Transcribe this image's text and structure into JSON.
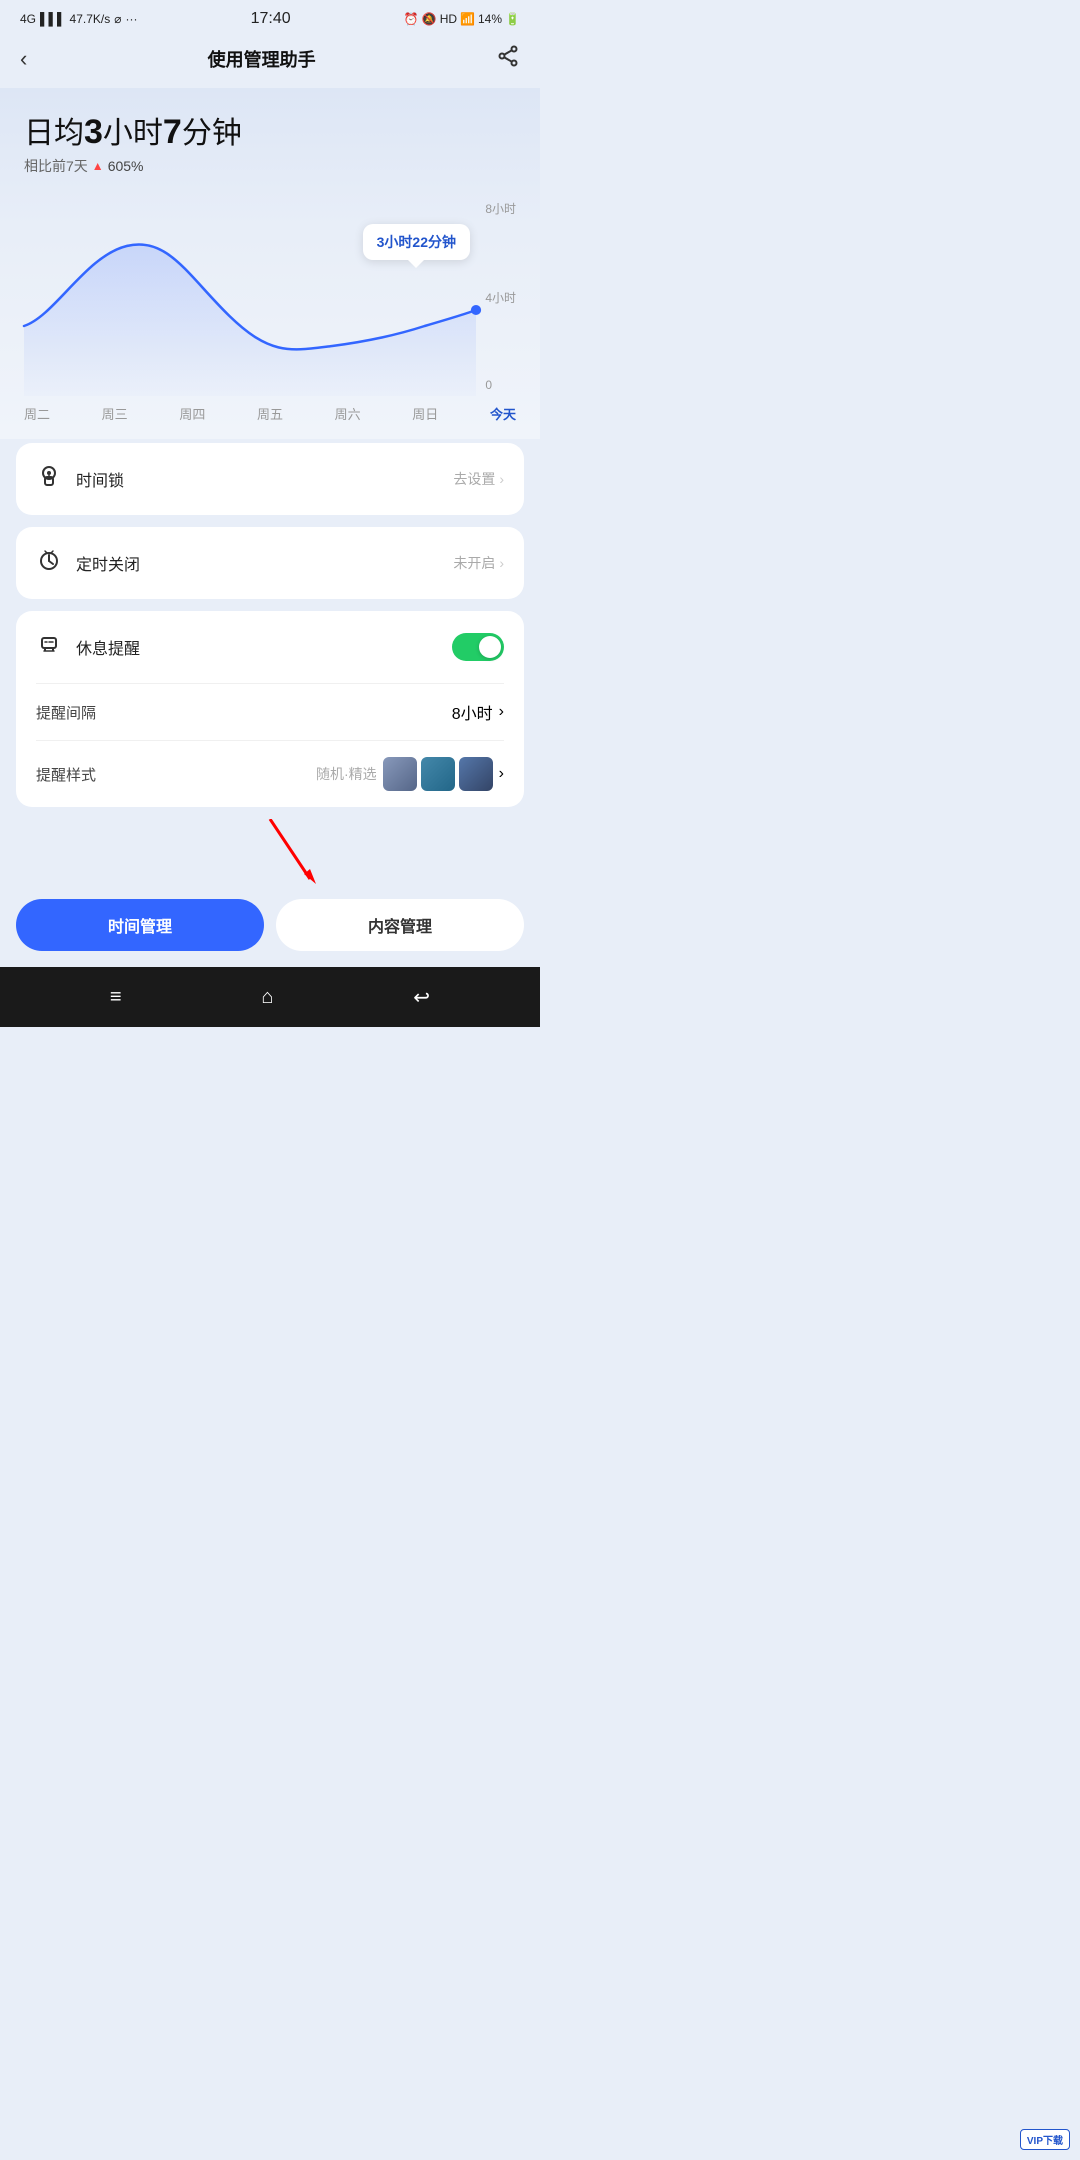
{
  "statusBar": {
    "network": "4G",
    "signal": "4G.ill",
    "speed": "47.7K/s",
    "usb": "⌀",
    "dots": "···",
    "time": "17:40",
    "alarm": "⏰",
    "mute": "🔕",
    "hd": "HD",
    "wifi": "WiFi",
    "battery": "14%"
  },
  "header": {
    "backLabel": "‹",
    "title": "使用管理助手",
    "shareLabel": "⎋"
  },
  "stats": {
    "prefixText": "日均",
    "hours": "3",
    "hoursLabel": "小时",
    "minutes": "7",
    "minutesLabel": "分钟",
    "comparisonText": "相比前7天",
    "arrowLabel": "▲",
    "percentText": "605%"
  },
  "chart": {
    "tooltip": "3小时22分钟",
    "yLabels": [
      "8小时",
      "4小时",
      "0"
    ],
    "xLabels": [
      {
        "label": "周二",
        "active": false
      },
      {
        "label": "周三",
        "active": false
      },
      {
        "label": "周四",
        "active": false
      },
      {
        "label": "周五",
        "active": false
      },
      {
        "label": "周六",
        "active": false
      },
      {
        "label": "周日",
        "active": false
      },
      {
        "label": "今天",
        "active": true
      }
    ]
  },
  "cards": [
    {
      "id": "time-lock",
      "icon": "⏱",
      "label": "时间锁",
      "rightText": "去设置",
      "hasChevron": true,
      "subRows": []
    },
    {
      "id": "scheduled-off",
      "icon": "⏰",
      "label": "定时关闭",
      "rightText": "未开启",
      "hasChevron": true,
      "subRows": []
    },
    {
      "id": "rest-reminder",
      "icon": "⏱",
      "label": "休息提醒",
      "rightText": "",
      "hasToggle": true,
      "toggleOn": true,
      "subRows": [
        {
          "label": "提醒间隔",
          "rightText": "8小时",
          "hasChevron": true
        },
        {
          "label": "提醒样式",
          "rightText": "随机·精选",
          "hasChevron": true,
          "hasPreviews": true
        }
      ]
    }
  ],
  "bottomTabs": [
    {
      "label": "时间管理",
      "active": true
    },
    {
      "label": "内容管理",
      "active": false
    }
  ],
  "navBar": {
    "menuIcon": "≡",
    "homeIcon": "⌂",
    "backIcon": "↩"
  }
}
